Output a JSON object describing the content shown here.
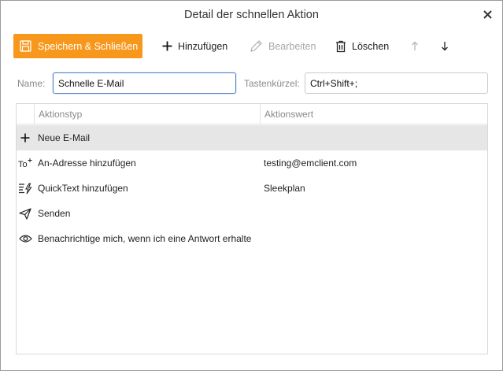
{
  "dialog": {
    "title": "Detail der schnellen Aktion"
  },
  "toolbar": {
    "save_close_label": "Speichern & Schließen",
    "add_label": "Hinzufügen",
    "edit_label": "Bearbeiten",
    "delete_label": "Löschen"
  },
  "form": {
    "name_label": "Name:",
    "name_value": "Schnelle E-Mail",
    "shortcut_label": "Tastenkürzel:",
    "shortcut_value": "Ctrl+Shift+;"
  },
  "table": {
    "columns": [
      "Aktionstyp",
      "Aktionswert"
    ],
    "rows": [
      {
        "icon": "plus-icon",
        "type": "Neue E-Mail",
        "value": ""
      },
      {
        "icon": "to-add-icon",
        "type": "An-Adresse hinzufügen",
        "value": "testing@emclient.com"
      },
      {
        "icon": "quicktext-icon",
        "type": "QuickText hinzufügen",
        "value": "Sleekplan"
      },
      {
        "icon": "send-icon",
        "type": "Senden",
        "value": ""
      },
      {
        "icon": "eye-icon",
        "type": "Benachrichtige mich, wenn ich eine Antwort erhalte",
        "value": ""
      }
    ]
  },
  "colors": {
    "accent": "#f7981d",
    "selected_row": "#e6e6e6",
    "focus_border": "#4a86c8"
  }
}
